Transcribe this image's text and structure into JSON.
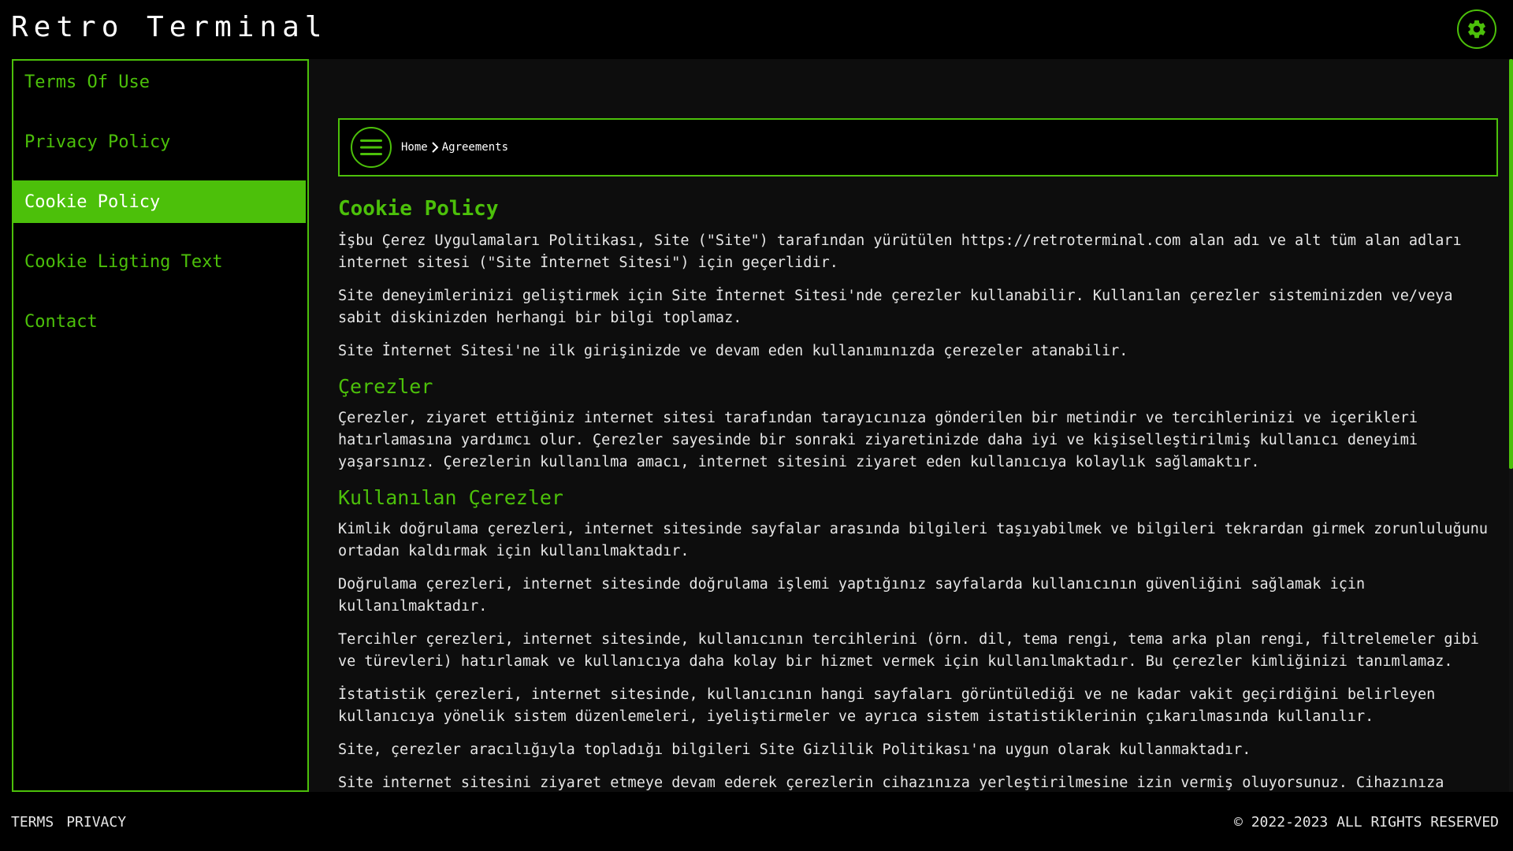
{
  "app": {
    "title": "Retro Terminal",
    "accent_color": "#4cc00a",
    "settings_icon": "gear-icon"
  },
  "sidebar": {
    "items": [
      {
        "label": "Terms Of Use",
        "active": false
      },
      {
        "label": "Privacy Policy",
        "active": false
      },
      {
        "label": "Cookie Policy",
        "active": true
      },
      {
        "label": "Cookie Ligting Text",
        "active": false
      },
      {
        "label": "Contact",
        "active": false
      }
    ]
  },
  "breadcrumb": {
    "menu_icon": "menu-icon",
    "separator_icon": "chevron-right-icon",
    "items": [
      "Home",
      "Agreements"
    ]
  },
  "article": {
    "title": "Cookie Policy",
    "intro": [
      "İşbu Çerez Uygulamaları Politikası, Site (\"Site\") tarafından yürütülen https://retroterminal.com alan adı ve alt tüm alan adları internet sitesi (\"Site İnternet Sitesi\") için geçerlidir.",
      "Site deneyimlerinizi geliştirmek için Site İnternet Sitesi'nde çerezler kullanabilir. Kullanılan çerezler sisteminizden ve/veya sabit diskinizden herhangi bir bilgi toplamaz.",
      "Site İnternet Sitesi'ne ilk girişinizde ve devam eden kullanımınızda çerezeler atanabilir."
    ],
    "section1_title": "Çerezler",
    "section1": [
      "Çerezler, ziyaret ettiğiniz internet sitesi tarafından tarayıcınıza gönderilen bir metindir ve tercihlerinizi ve içerikleri hatırlamasına yardımcı olur. Çerezler sayesinde bir sonraki ziyaretinizde daha iyi ve kişiselleştirilmiş kullanıcı deneyimi yaşarsınız. Çerezlerin kullanılma amacı, internet sitesini ziyaret eden kullanıcıya kolaylık sağlamaktır."
    ],
    "section2_title": "Kullanılan Çerezler",
    "section2": [
      "Kimlik doğrulama çerezleri, internet sitesinde sayfalar arasında bilgileri taşıyabilmek ve bilgileri tekrardan girmek zorunluluğunu ortadan kaldırmak için kullanılmaktadır.",
      "Doğrulama çerezleri, internet sitesinde doğrulama işlemi yaptığınız sayfalarda kullanıcının güvenliğini sağlamak için kullanılmaktadır.",
      "Tercihler çerezleri, internet sitesinde, kullanıcının tercihlerini (örn. dil, tema rengi, tema arka plan rengi, filtrelemeler gibi ve türevleri) hatırlamak ve kullanıcıya daha kolay bir hizmet vermek için kullanılmaktadır. Bu çerezler kimliğinizi tanımlamaz.",
      "İstatistik çerezleri, internet sitesinde, kullanıcının hangi sayfaları görüntülediği ve ne kadar vakit geçirdiğini belirleyen kullanıcıya yönelik sistem düzenlemeleri, iyeliştirmeler ve ayrıca sistem istatistiklerinin çıkarılmasında kullanılır.",
      "Site, çerezler aracılığıyla topladığı bilgileri Site Gizlilik Politikası'na uygun olarak kullanmaktadır.",
      "Site internet sitesini ziyaret etmeye devam ederek çerezlerin cihazınıza yerleştirilmesine izin vermiş oluyorsunuz. Cihazınıza çerezler"
    ]
  },
  "footer": {
    "links": [
      "TERMS",
      "PRIVACY"
    ],
    "copyright": "© 2022-2023 ALL RIGHTS RESERVED"
  }
}
